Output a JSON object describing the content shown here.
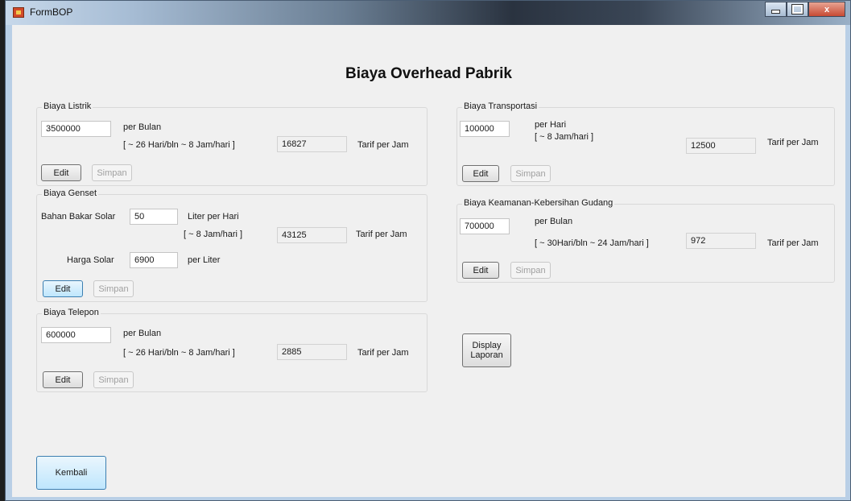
{
  "window": {
    "title": "FormBOP",
    "controls": {
      "close": "x"
    }
  },
  "heading": "Biaya Overhead Pabrik",
  "listrik": {
    "title": "Biaya Listrik",
    "value": "3500000",
    "unit": "per Bulan",
    "note": "[ ~ 26 Hari/bln ~ 8 Jam/hari ]",
    "rate": "16827",
    "rate_label": "Tarif per Jam",
    "edit": "Edit",
    "simpan": "Simpan"
  },
  "genset": {
    "title": "Biaya Genset",
    "bbm_label": "Bahan Bakar Solar",
    "bbm_value": "50",
    "bbm_unit": "Liter per Hari",
    "note": "[ ~ 8 Jam/hari ]",
    "rate": "43125",
    "rate_label": "Tarif per Jam",
    "harga_label": "Harga Solar",
    "harga_value": "6900",
    "harga_unit": "per Liter",
    "edit": "Edit",
    "simpan": "Simpan"
  },
  "telepon": {
    "title": "Biaya Telepon",
    "value": "600000",
    "unit": "per Bulan",
    "note": "[ ~ 26 Hari/bln ~ 8 Jam/hari ]",
    "rate": "2885",
    "rate_label": "Tarif per Jam",
    "edit": "Edit",
    "simpan": "Simpan"
  },
  "transportasi": {
    "title": "Biaya Transportasi",
    "value": "100000",
    "unit": "per Hari",
    "note": "[ ~ 8 Jam/hari ]",
    "rate": "12500",
    "rate_label": "Tarif per Jam",
    "edit": "Edit",
    "simpan": "Simpan"
  },
  "keamanan": {
    "title": "Biaya Keamanan-Kebersihan  Gudang",
    "value": "700000",
    "unit": "per Bulan",
    "note": "[ ~ 30Hari/bln ~ 24 Jam/hari ]",
    "rate": "972",
    "rate_label": "Tarif per Jam",
    "edit": "Edit",
    "simpan": "Simpan"
  },
  "display_button": {
    "line1": "Display",
    "line2": "Laporan"
  },
  "kembali_button": "Kembali"
}
